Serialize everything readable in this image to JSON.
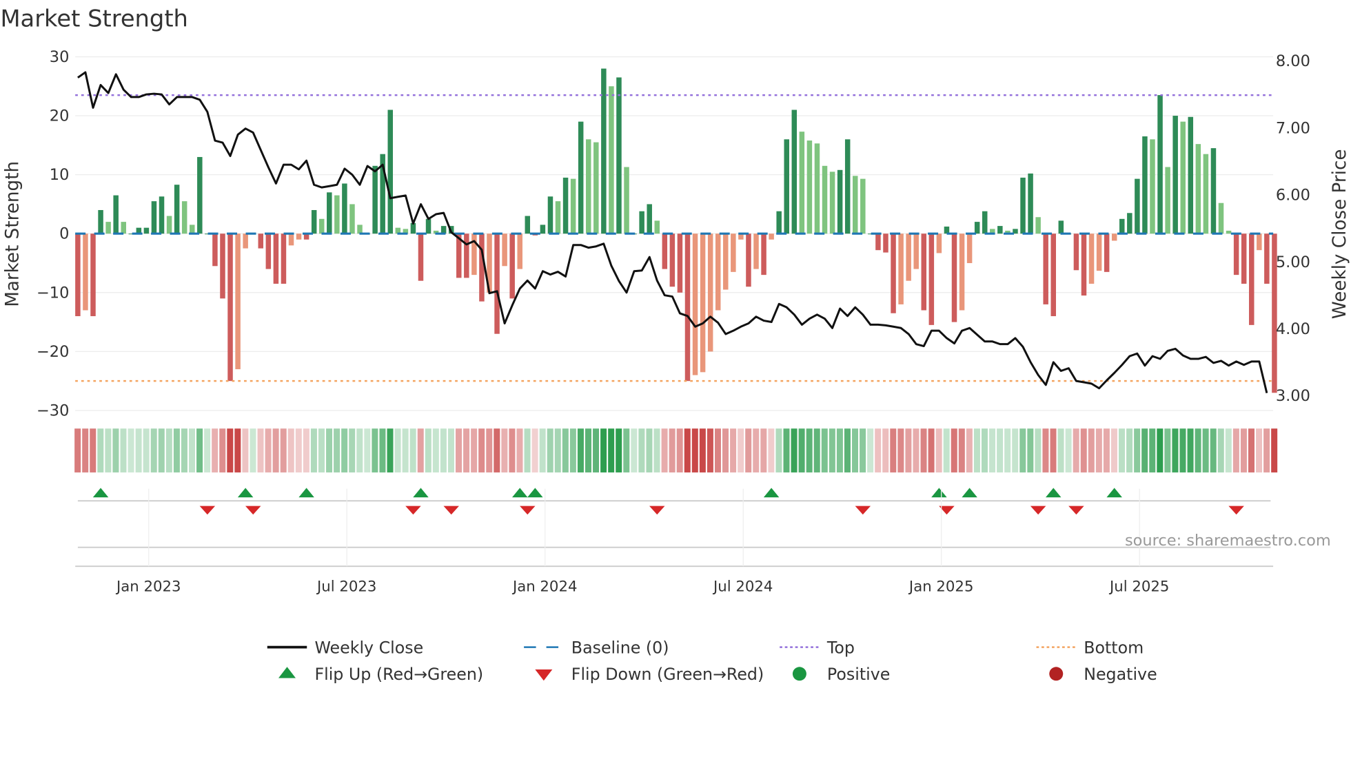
{
  "chart_data": {
    "type": "bar",
    "title": "Market Strength",
    "ylabel": "Market Strength",
    "y2label": "Weekly Close Price",
    "ylim": [
      -30,
      30
    ],
    "y2lim": [
      2.87,
      8.05
    ],
    "yticks": [
      "30",
      "20",
      "10",
      "0",
      "−10",
      "−20",
      "−30"
    ],
    "ytick_values": [
      30,
      20,
      10,
      0,
      -10,
      -20,
      -30
    ],
    "y2ticks": [
      "8.00",
      "7.00",
      "6.00",
      "5.00",
      "4.00",
      "3.00"
    ],
    "y2tick_values": [
      8,
      7,
      6,
      5,
      4,
      3
    ],
    "xticks": [
      "Jan 2023",
      "Jul 2023",
      "Jan 2024",
      "Jul 2024",
      "Jan 2025",
      "Jul 2025"
    ],
    "xtick_week_index": [
      9.3,
      35.3,
      61.3,
      87.3,
      113.3,
      139.3
    ],
    "x_start_week": "2022-10-31",
    "x_frequency": "weekly",
    "top_level": 23.5,
    "bottom_level": -25,
    "baseline": 0,
    "strength": [
      -14,
      -13,
      -14,
      4,
      2,
      6.5,
      2,
      0,
      1,
      1,
      5.5,
      6.3,
      3,
      8.3,
      5.5,
      1.5,
      13,
      0,
      -5.5,
      -11,
      -25,
      -23,
      -2.5,
      0,
      -2.5,
      -6,
      -8.5,
      -8.5,
      -2,
      -1,
      -1,
      4,
      2.5,
      7,
      6.5,
      8.5,
      5,
      1.5,
      0,
      11.5,
      13.5,
      21,
      1,
      0.8,
      1.8,
      -8,
      2.5,
      0.5,
      1.3,
      1.3,
      -7.5,
      -7.5,
      -7,
      -11.5,
      -10,
      -17,
      -5.5,
      -11,
      -6,
      3,
      -0.3,
      1.5,
      6.3,
      5.5,
      9.5,
      9.3,
      19,
      16,
      15.5,
      28,
      25,
      26.5,
      11.3,
      0,
      3.8,
      5,
      2.2,
      -6,
      -9,
      -10,
      -25,
      -24,
      -23.5,
      -20,
      -13,
      -9.5,
      -6.5,
      -1,
      -9,
      -6,
      -7,
      -1,
      3.8,
      16,
      21,
      17.3,
      15.8,
      15.3,
      11.5,
      10.5,
      10.8,
      16,
      9.8,
      9.3,
      0,
      -2.8,
      -3.2,
      -13.5,
      -12,
      -8,
      -6,
      -13,
      -15.5,
      -3.3,
      1.2,
      -15,
      -13,
      -5,
      2,
      3.8,
      0.8,
      1.3,
      0.5,
      0.8,
      9.5,
      10.2,
      2.8,
      -12,
      -14,
      2.2,
      0,
      -6.2,
      -10.5,
      -8.5,
      -6.3,
      -6.5,
      -1.2,
      2.5,
      3.5,
      9.3,
      16.5,
      16,
      23.5,
      11.3,
      20,
      19,
      19.8,
      15.2,
      13.5,
      14.5,
      5.2,
      0.5,
      -7,
      -8.5,
      -15.5,
      -2.8,
      -8.5,
      -27
    ],
    "weekly_close": [
      7.74,
      7.82,
      7.29,
      7.63,
      7.51,
      7.79,
      7.56,
      7.45,
      7.45,
      7.49,
      7.5,
      7.49,
      7.34,
      7.45,
      7.45,
      7.45,
      7.41,
      7.23,
      6.8,
      6.77,
      6.57,
      6.89,
      6.98,
      6.92,
      6.66,
      6.4,
      6.16,
      6.44,
      6.44,
      6.37,
      6.5,
      6.14,
      6.1,
      6.12,
      6.14,
      6.38,
      6.29,
      6.14,
      6.42,
      6.34,
      6.44,
      5.94,
      5.96,
      5.98,
      5.56,
      5.85,
      5.63,
      5.7,
      5.72,
      5.43,
      5.34,
      5.25,
      5.3,
      5.17,
      4.52,
      4.55,
      4.07,
      4.34,
      4.59,
      4.71,
      4.59,
      4.85,
      4.8,
      4.84,
      4.77,
      5.24,
      5.24,
      5.2,
      5.22,
      5.26,
      4.93,
      4.7,
      4.53,
      4.85,
      4.86,
      5.06,
      4.71,
      4.49,
      4.47,
      4.22,
      4.18,
      4.02,
      4.07,
      4.17,
      4.08,
      3.91,
      3.96,
      4.02,
      4.07,
      4.17,
      4.11,
      4.09,
      4.36,
      4.31,
      4.2,
      4.05,
      4.14,
      4.2,
      4.14,
      4.0,
      4.29,
      4.18,
      4.31,
      4.2,
      4.05,
      4.05,
      4.04,
      4.02,
      4.0,
      3.91,
      3.76,
      3.73,
      3.96,
      3.96,
      3.85,
      3.77,
      3.96,
      4.0,
      3.9,
      3.8,
      3.8,
      3.76,
      3.76,
      3.85,
      3.72,
      3.49,
      3.3,
      3.15,
      3.49,
      3.36,
      3.4,
      3.21,
      3.19,
      3.17,
      3.1,
      3.22,
      3.33,
      3.45,
      3.58,
      3.62,
      3.44,
      3.58,
      3.54,
      3.66,
      3.69,
      3.59,
      3.54,
      3.54,
      3.57,
      3.48,
      3.51,
      3.44,
      3.5,
      3.45,
      3.5,
      3.5,
      3.03
    ],
    "flip_up_week_index": [
      3,
      22,
      30,
      45,
      58,
      60,
      91,
      113,
      117,
      128,
      136
    ],
    "flip_down_week_index": [
      17,
      23,
      44,
      49,
      59,
      76,
      103,
      114,
      126,
      131,
      152
    ],
    "legend": [
      {
        "label": "Weekly Close",
        "kind": "line"
      },
      {
        "label": "Baseline (0)",
        "kind": "dash"
      },
      {
        "label": "Top",
        "kind": "dot-purple"
      },
      {
        "label": "Bottom",
        "kind": "dot-orange"
      },
      {
        "label": "Flip Up (Red→Green)",
        "kind": "tri-up"
      },
      {
        "label": "Flip Down (Green→Red)",
        "kind": "tri-down"
      },
      {
        "label": "Positive",
        "kind": "circle-green"
      },
      {
        "label": "Negative",
        "kind": "circle-red"
      }
    ],
    "legend_placement": "bottom",
    "source": "source: sharemaestro.com"
  },
  "colors": {
    "pos_strong": "#2e8b57",
    "pos_weak": "#7fc47f",
    "neg_strong": "#cd5c5c",
    "neg_weak": "#e9967a",
    "line": "#111111",
    "baseline": "#1f77b4",
    "top": "#9370db",
    "bottom": "#f4a460",
    "flip_up": "#1a9641",
    "flip_down": "#d62728",
    "grid": "#ececec"
  }
}
